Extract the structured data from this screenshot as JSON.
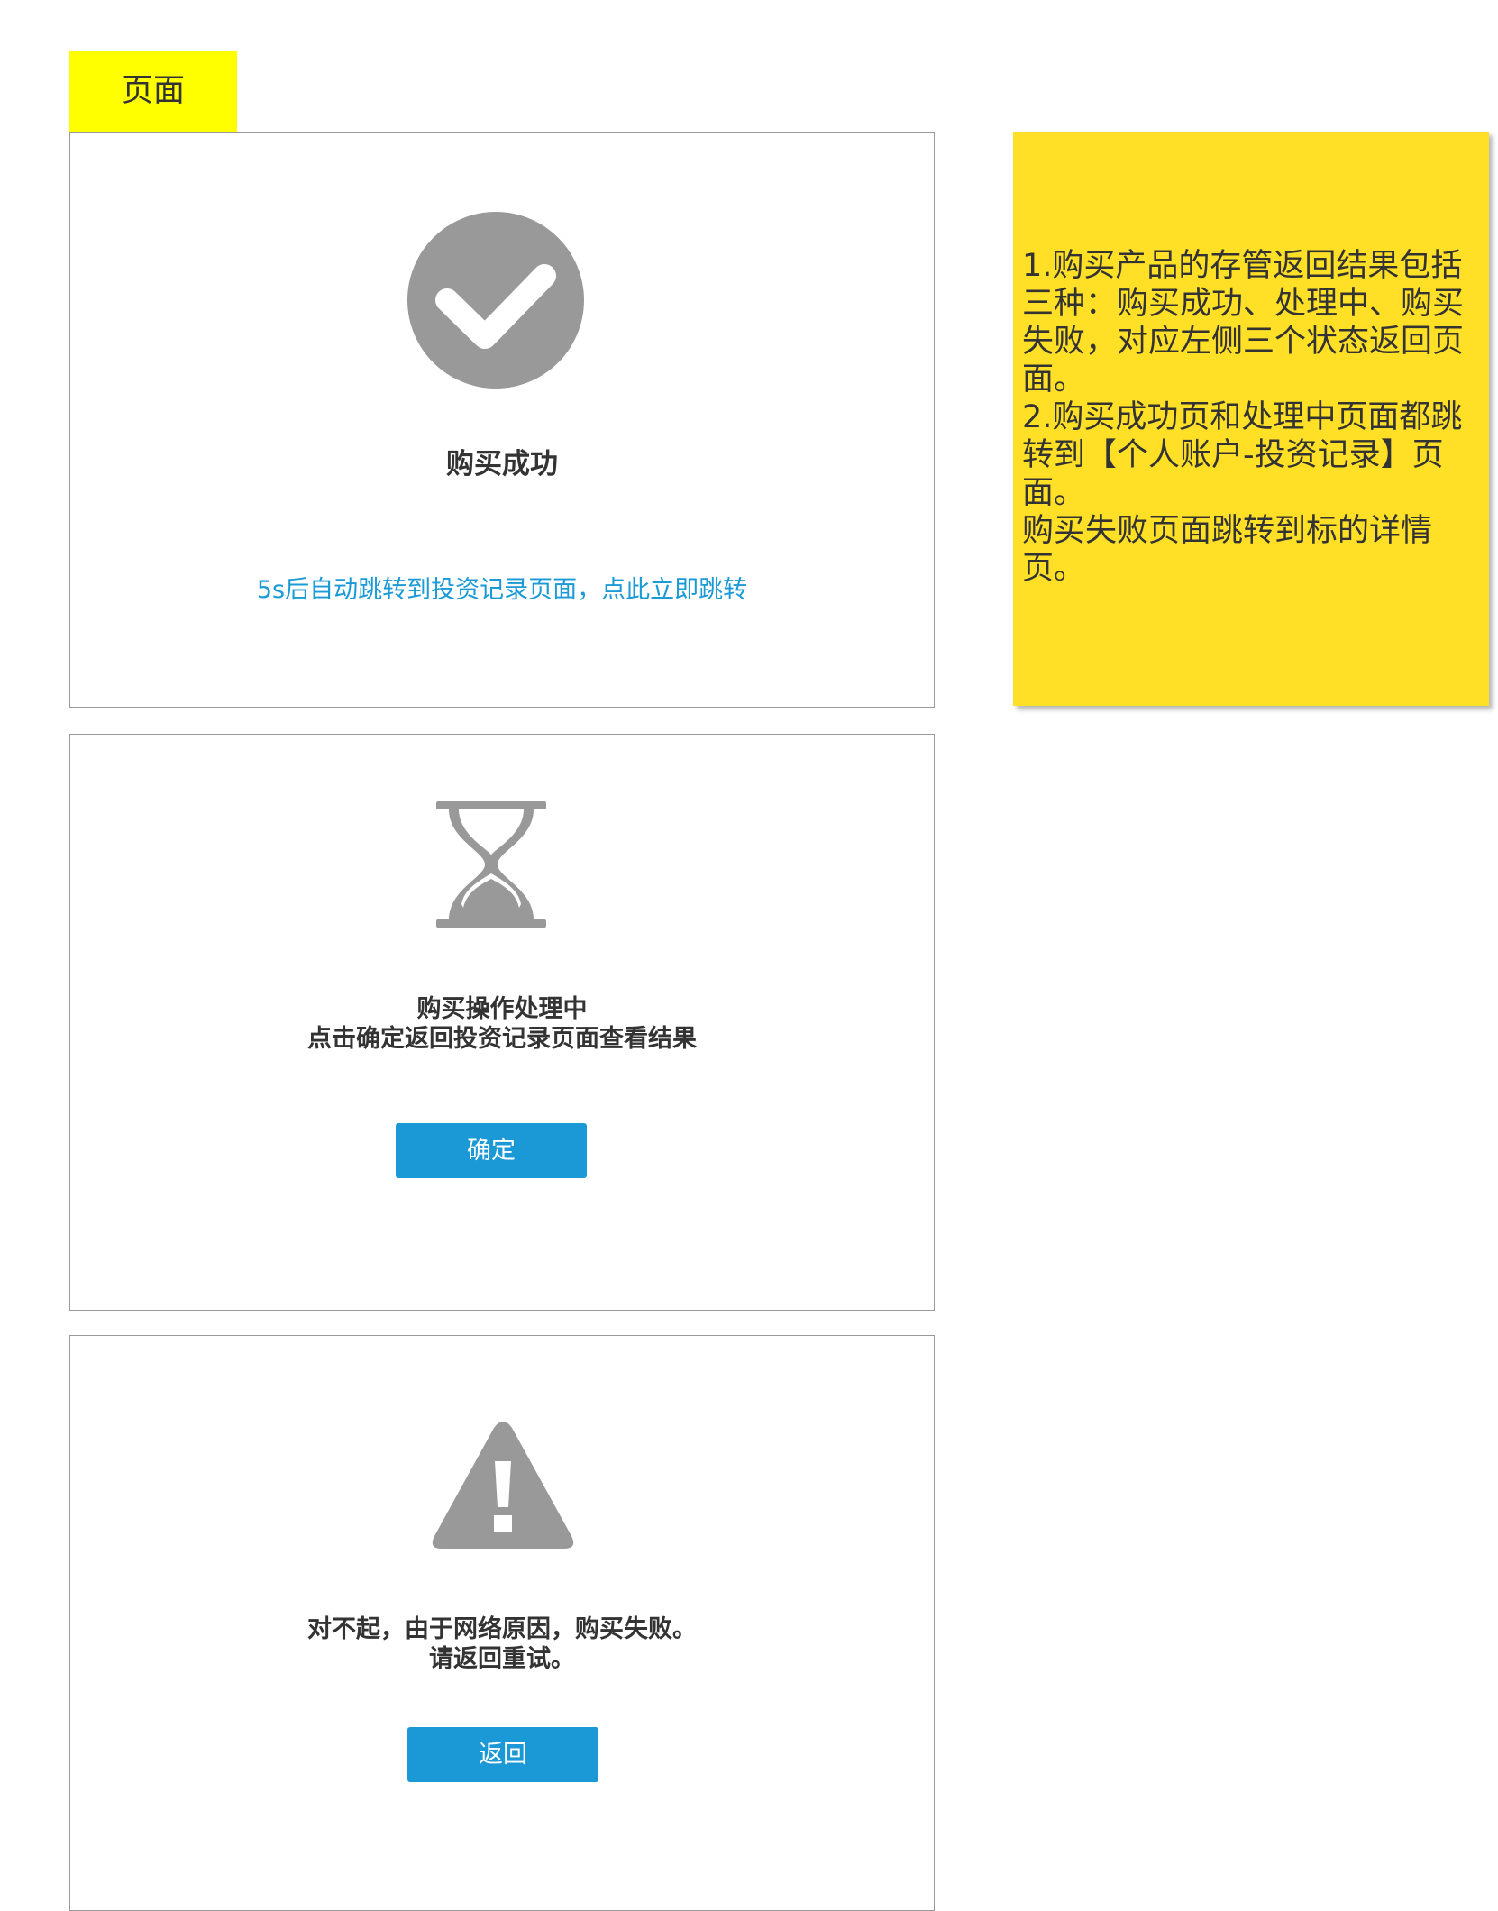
{
  "page_tab": {
    "label": "页面"
  },
  "success_panel": {
    "icon": "check-circle-icon",
    "title": "购买成功",
    "redirect_text": "5s后自动跳转到投资记录页面，点此立即跳转"
  },
  "processing_panel": {
    "icon": "hourglass-icon",
    "title_lines": [
      "购买操作处理中",
      "点击确定返回投资记录页面查看结果"
    ],
    "confirm_label": "确定"
  },
  "failure_panel": {
    "icon": "warning-triangle-icon",
    "title_lines": [
      "对不起，由于网络原因，购买失败。",
      "请返回重试。"
    ],
    "back_label": "返回"
  },
  "note": {
    "lines": [
      "1.购买产品的存管返回结果包括三种：购买成功、处理中、购买失败，对应左侧三个状态返回页面。",
      "2.购买成功页和处理中页面都跳转到【个人账户-投资记录】页面。",
      "购买失败页面跳转到标的详情页。"
    ]
  },
  "colors": {
    "tab_background": "#ffff00",
    "note_background": "#ffe026",
    "accent_blue": "#1b98d6",
    "link_blue": "#1a9ad6",
    "icon_gray": "#999999",
    "text_dark": "#333333",
    "panel_border": "#9a9a9a"
  }
}
